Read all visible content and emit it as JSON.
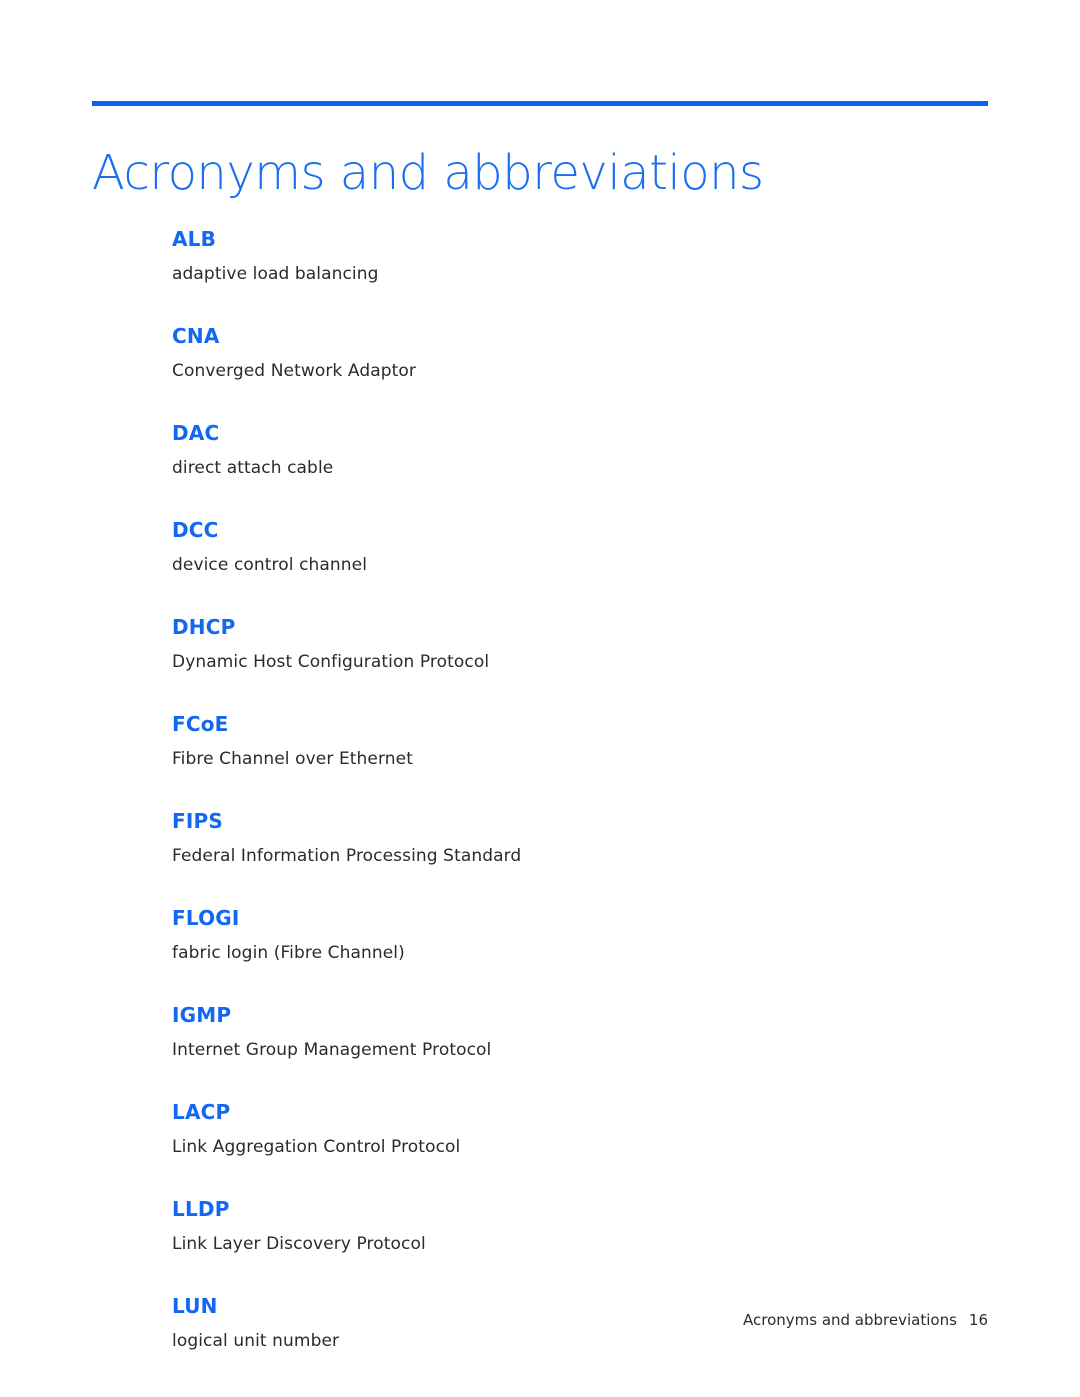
{
  "document": {
    "title": "Acronyms and abbreviations",
    "accent_color": "#0b63f6",
    "term_color": "#1268f2",
    "body_color": "#2b2b2b",
    "background_color": "#ffffff"
  },
  "glossary": {
    "entries": [
      {
        "term": "ALB",
        "definition": "adaptive load balancing"
      },
      {
        "term": "CNA",
        "definition": "Converged Network Adaptor"
      },
      {
        "term": "DAC",
        "definition": "direct attach cable"
      },
      {
        "term": "DCC",
        "definition": "device control channel"
      },
      {
        "term": "DHCP",
        "definition": "Dynamic Host Configuration Protocol"
      },
      {
        "term": "FCoE",
        "definition": "Fibre Channel over Ethernet"
      },
      {
        "term": "FIPS",
        "definition": "Federal Information Processing Standard"
      },
      {
        "term": "FLOGI",
        "definition": "fabric login (Fibre Channel)"
      },
      {
        "term": "IGMP",
        "definition": "Internet Group Management Protocol"
      },
      {
        "term": "LACP",
        "definition": "Link Aggregation Control Protocol"
      },
      {
        "term": "LLDP",
        "definition": "Link Layer Discovery Protocol"
      },
      {
        "term": "LUN",
        "definition": "logical unit number"
      }
    ]
  },
  "footer": {
    "section_label": "Acronyms and abbreviations",
    "page_number": "16"
  }
}
